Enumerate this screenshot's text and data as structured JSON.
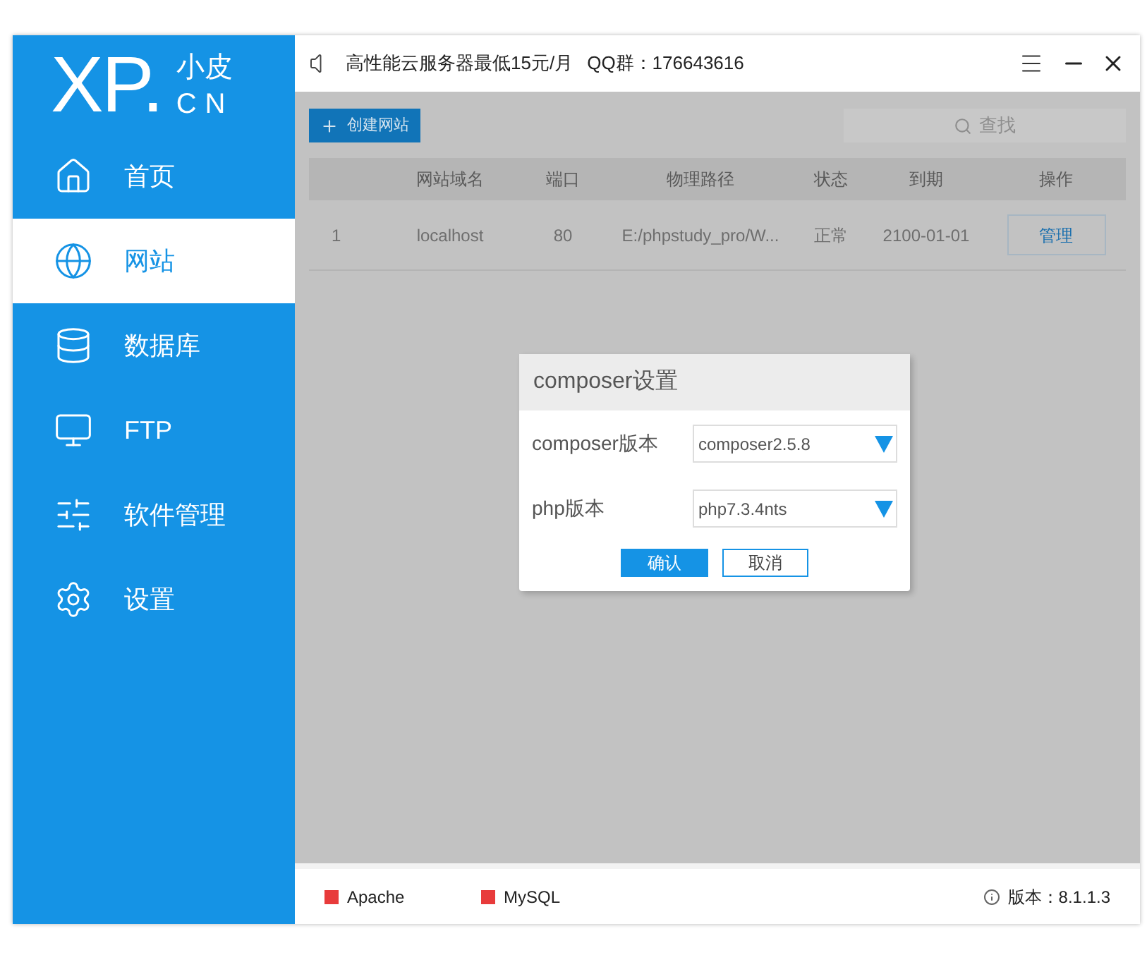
{
  "logo": {
    "mark": "XP.",
    "name": "小皮",
    "domain": "CN"
  },
  "nav": [
    {
      "kind": "home",
      "label": "首页",
      "selected": false
    },
    {
      "kind": "website",
      "label": "网站",
      "selected": true
    },
    {
      "kind": "database",
      "label": "数据库",
      "selected": false
    },
    {
      "kind": "ftp",
      "label": "FTP",
      "selected": false
    },
    {
      "kind": "software",
      "label": "软件管理",
      "selected": false
    },
    {
      "kind": "settings",
      "label": "设置",
      "selected": false
    }
  ],
  "header": {
    "notice": "高性能云服务器最低15元/月",
    "qq": "QQ群：176643616"
  },
  "toolbar": {
    "create_button": "创建网站",
    "search_placeholder": "查找"
  },
  "table": {
    "columns": [
      "",
      "网站域名",
      "端口",
      "物理路径",
      "状态",
      "到期",
      "操作"
    ],
    "rows": [
      {
        "cells": [
          "1",
          "localhost",
          "80",
          "E:/phpstudy_pro/W...",
          "正常",
          "2100-01-01"
        ],
        "action": "管理"
      }
    ]
  },
  "dialog": {
    "title": "composer设置",
    "fields": [
      {
        "label": "composer版本",
        "value": "composer2.5.8"
      },
      {
        "label": "php版本",
        "value": "php7.3.4nts"
      }
    ],
    "confirm": "确认",
    "cancel": "取消"
  },
  "status_bar": {
    "services": [
      {
        "name": "Apache",
        "color": "#e83b3b"
      },
      {
        "name": "MySQL",
        "color": "#e83b3b"
      }
    ],
    "version": "版本：8.1.1.3"
  }
}
